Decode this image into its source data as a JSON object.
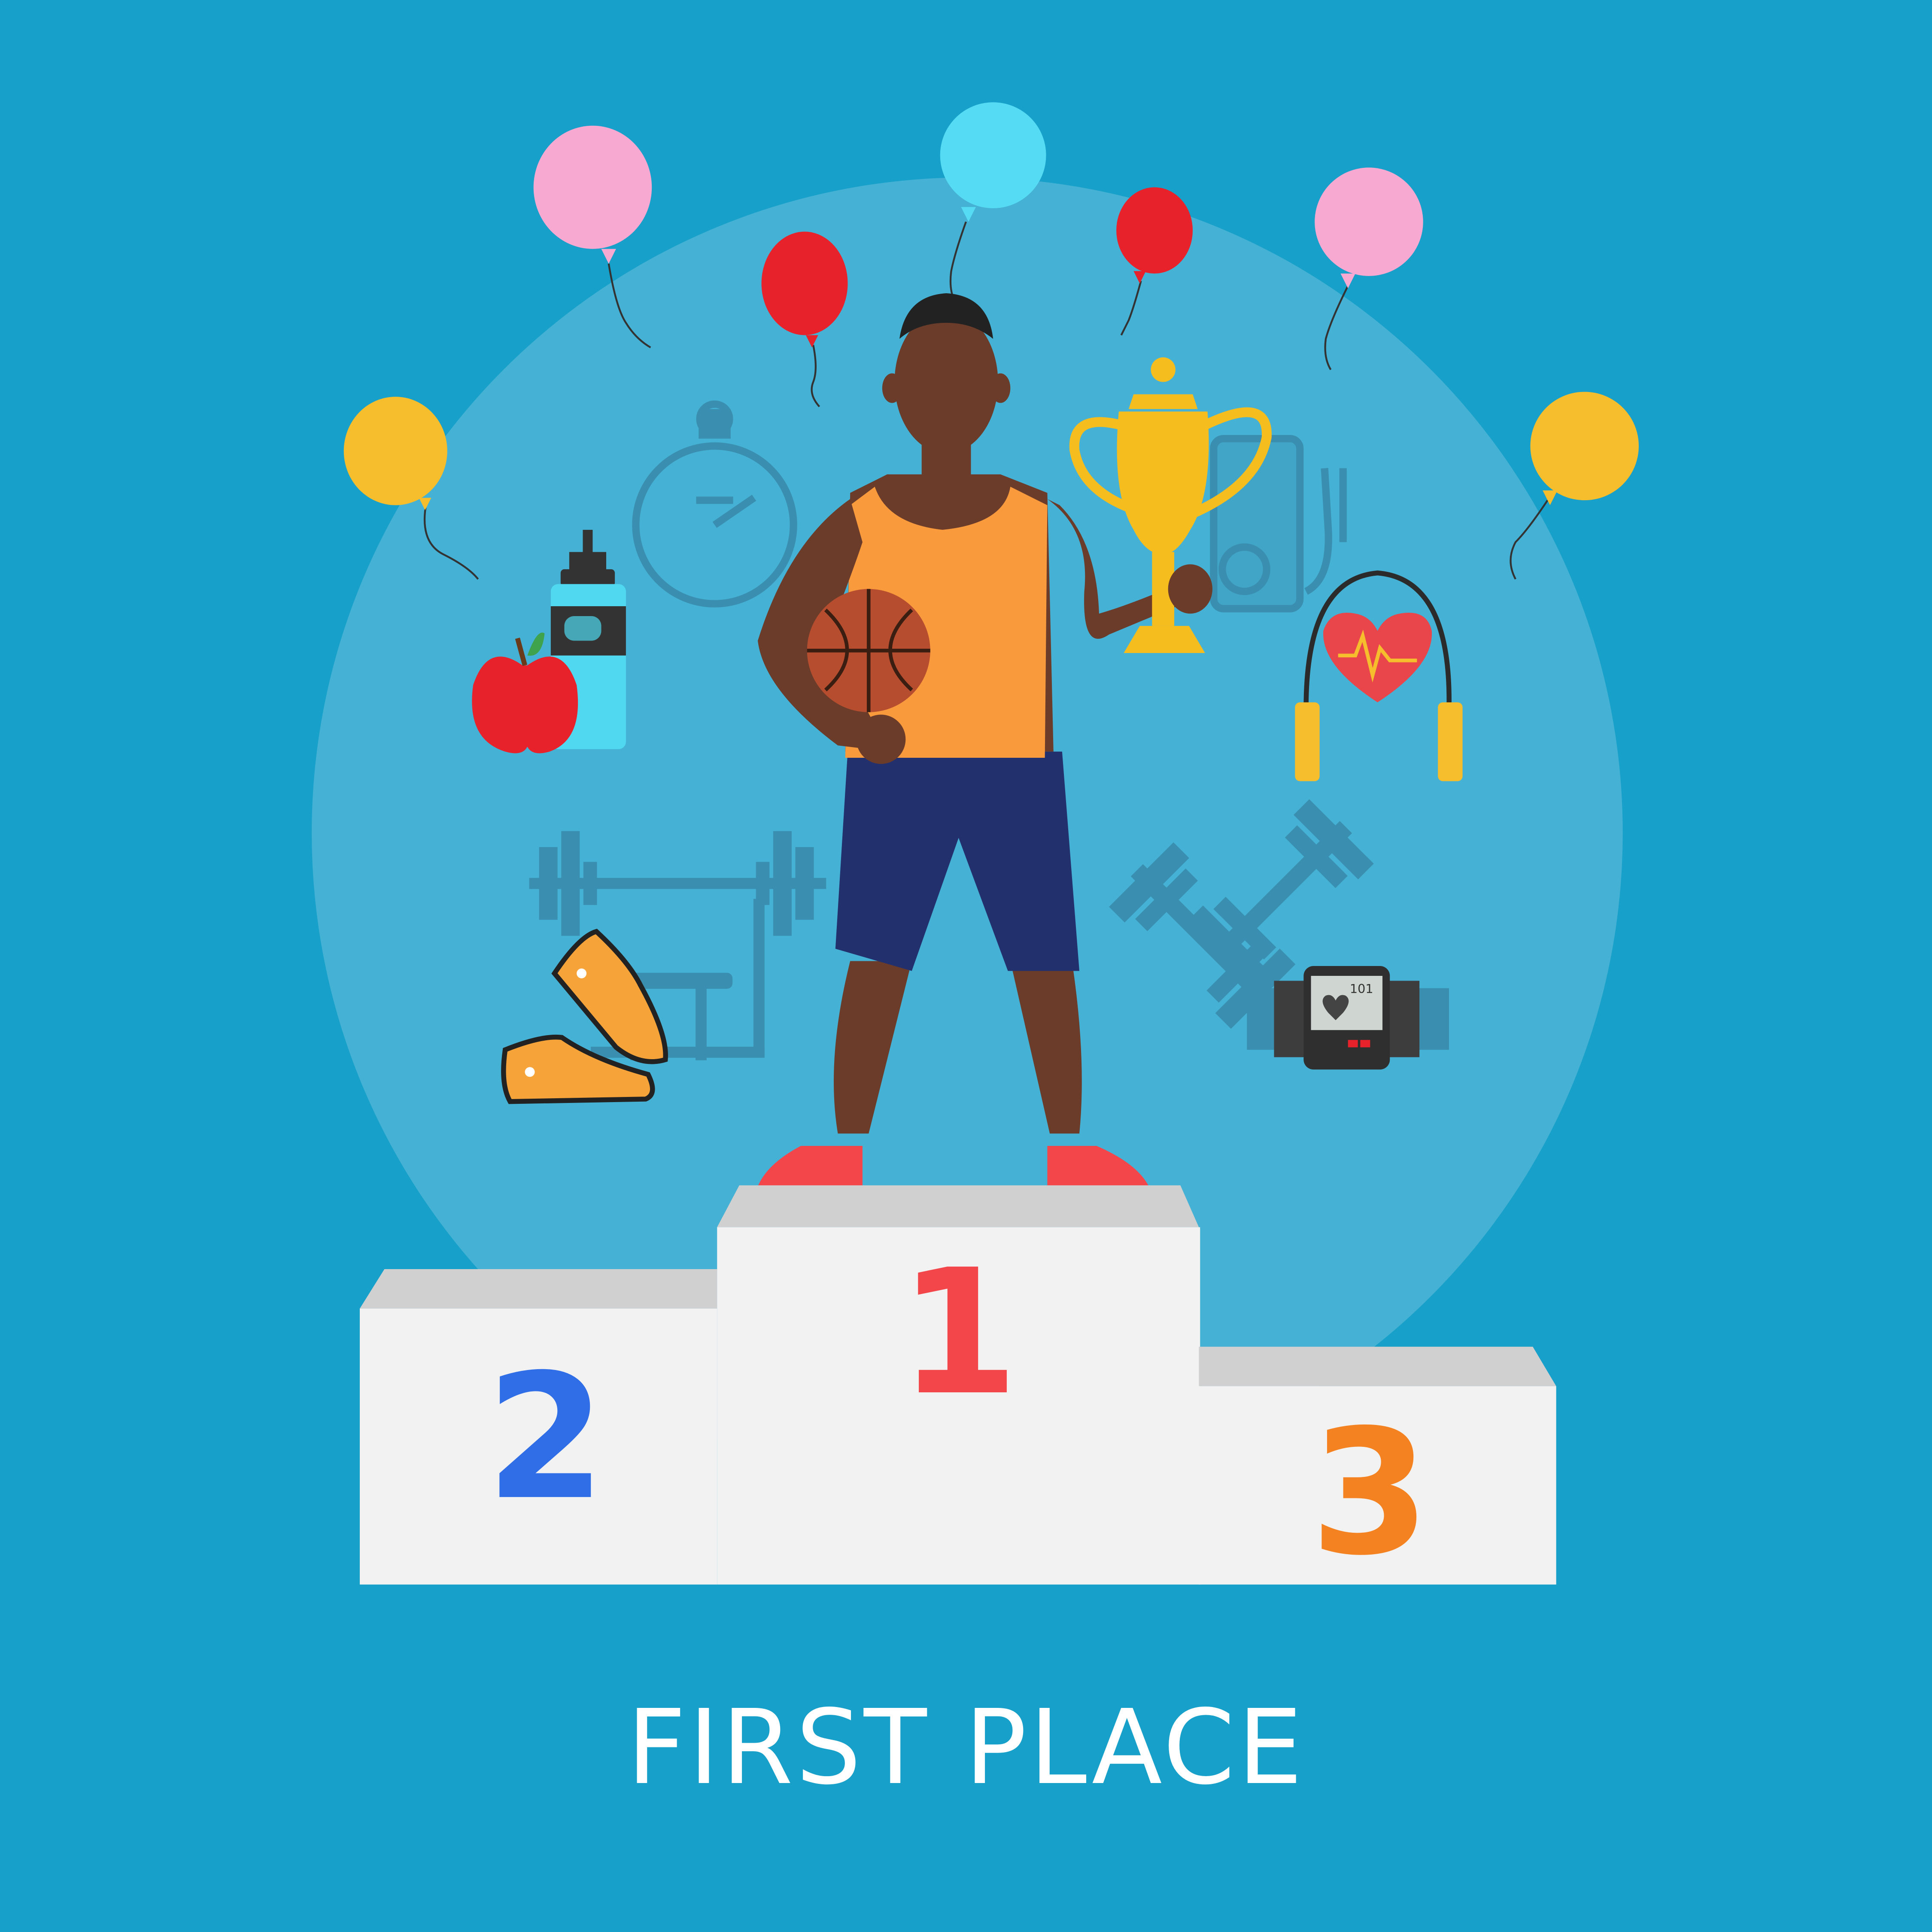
{
  "caption": "FIRST PLACE",
  "podium": {
    "first": "1",
    "second": "2",
    "third": "3"
  },
  "monitor_readout": "101",
  "colors": {
    "background": "#17a0c9",
    "circle": "#45b1d4",
    "icon_line": "#3a8fb0",
    "podium_face": "#f2f2f2",
    "podium_top": "#d0d0d0",
    "first": "#f2464b",
    "second": "#2f6ee6",
    "third": "#f58220",
    "jersey": "#f99a3c",
    "shorts": "#23306e",
    "skin": "#6b3c2a",
    "trophy": "#f6bd1f"
  },
  "icons": [
    "balloon-icon",
    "stopwatch-icon",
    "water-bottle-icon",
    "apple-icon",
    "music-player-icon",
    "jump-rope-icon",
    "heart-icon",
    "barbell-icon",
    "sneakers-icon",
    "dumbbells-icon",
    "heart-rate-monitor-icon",
    "trophy-icon",
    "basketball-icon"
  ]
}
